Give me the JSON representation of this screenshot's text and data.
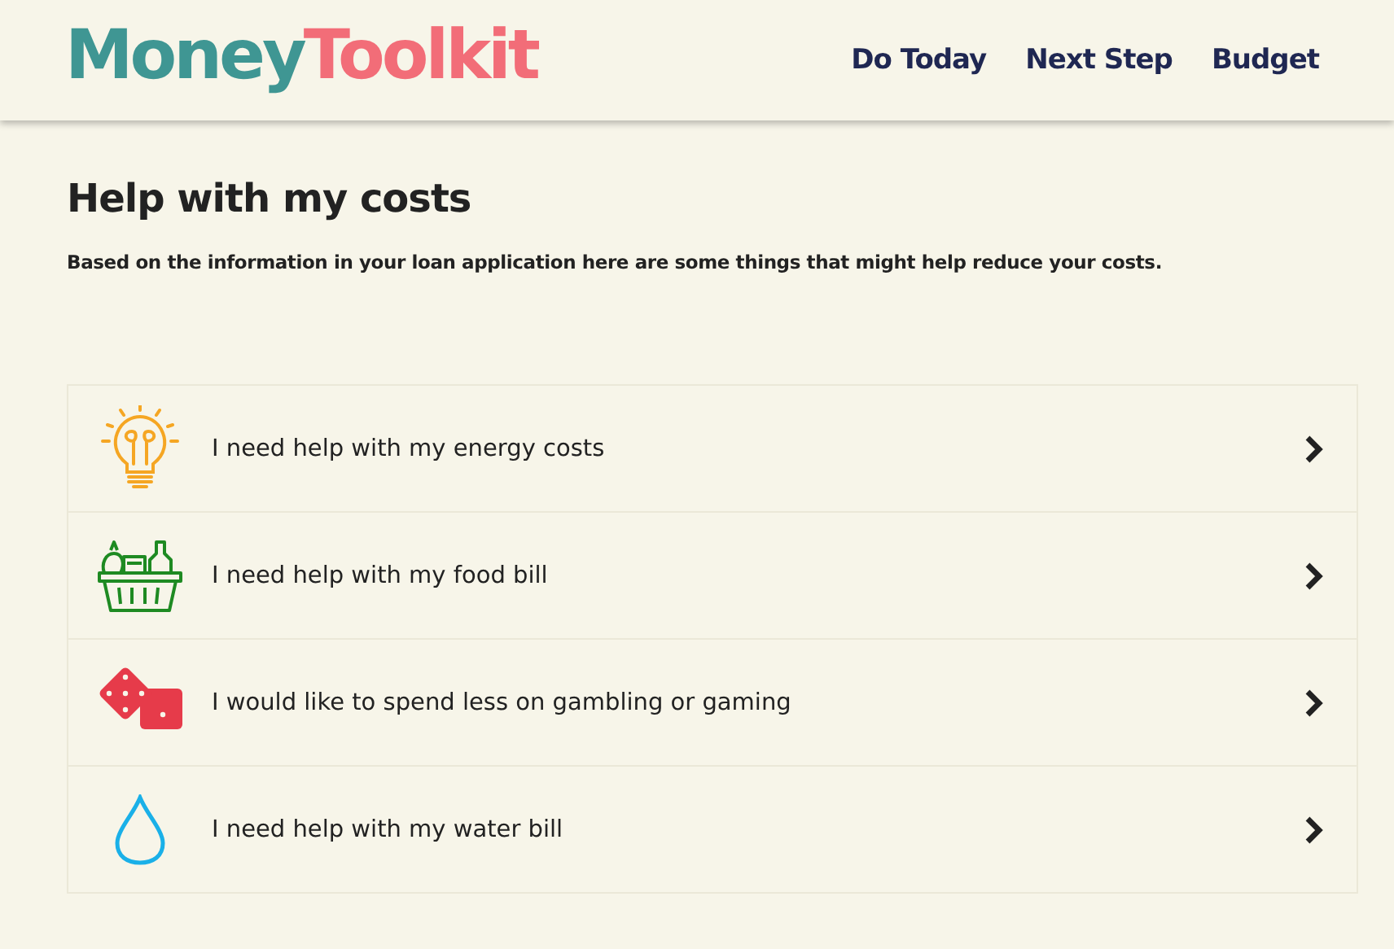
{
  "logo": {
    "part_1": "Money",
    "part_2": "Toolkit"
  },
  "nav": [
    "Do Today",
    "Next Step",
    "Budget"
  ],
  "heading": "Help with my costs",
  "intro": "Based on the information in your loan application here are some things that might help reduce your costs.",
  "options": [
    {
      "kind": "energy",
      "label": "I need help with my energy costs"
    },
    {
      "kind": "food",
      "label": "I need help with my food bill"
    },
    {
      "kind": "gambling",
      "label": "I would like to spend less on gambling or gaming"
    },
    {
      "kind": "water",
      "label": "I need help with my water bill"
    }
  ]
}
